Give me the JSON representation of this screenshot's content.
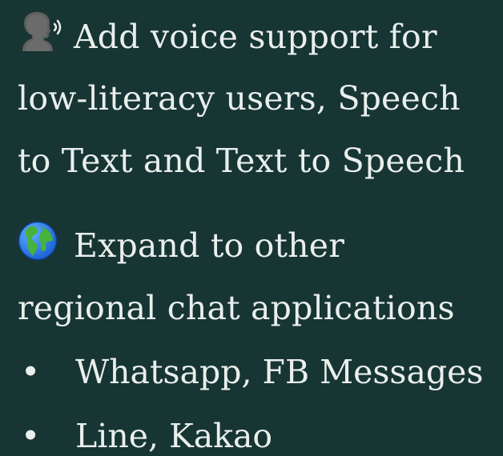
{
  "item1": {
    "icon": "speaking-head-icon",
    "lines": [
      "Add voice support for",
      "low-literacy users, Speech",
      "to Text and Text to Speech"
    ]
  },
  "item2": {
    "icon": "globe-icon",
    "lines": [
      "Expand to other",
      "regional chat applications"
    ]
  },
  "bullets": {
    "marker": "•",
    "items": [
      "Whatsapp, FB Messages",
      "Line, Kakao"
    ]
  }
}
